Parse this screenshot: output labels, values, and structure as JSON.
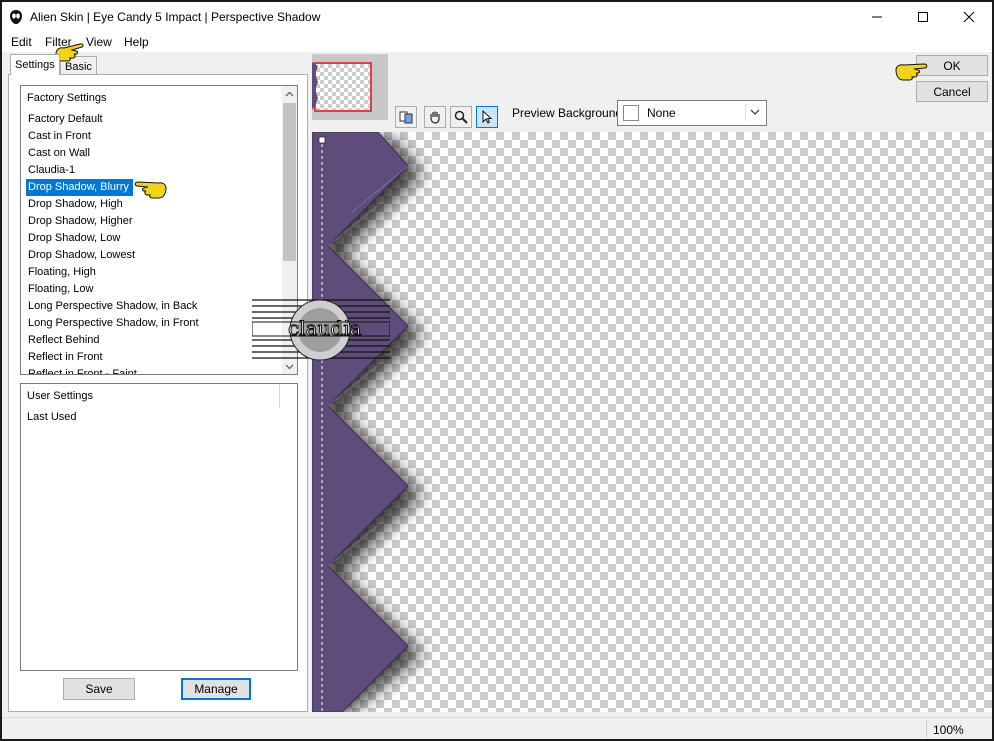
{
  "window": {
    "title": "Alien Skin | Eye Candy 5 Impact | Perspective Shadow"
  },
  "menu": [
    "Edit",
    "Filter",
    "View",
    "Help"
  ],
  "tabs": {
    "settings": "Settings",
    "basic": "Basic"
  },
  "factory": {
    "header": "Factory Settings",
    "items": [
      "Factory Default",
      "Cast in Front",
      "Cast on Wall",
      "Claudia-1",
      "Drop Shadow, Blurry",
      "Drop Shadow, High",
      "Drop Shadow, Higher",
      "Drop Shadow, Low",
      "Drop Shadow, Lowest",
      "Floating, High",
      "Floating, Low",
      "Long Perspective Shadow, in Back",
      "Long Perspective Shadow, in Front",
      "Reflect Behind",
      "Reflect in Front",
      "Reflect in Front - Faint"
    ],
    "selected_index": 4
  },
  "user": {
    "header": "User Settings",
    "items": [
      "Last Used"
    ]
  },
  "buttons": {
    "save": "Save",
    "manage": "Manage",
    "ok": "OK",
    "cancel": "Cancel"
  },
  "preview_background": {
    "label": "Preview Background:",
    "value": "None"
  },
  "status": {
    "zoom": "100%"
  },
  "watermark": {
    "text": "claudia"
  },
  "colors": {
    "selection": "#0078d7",
    "shape": "#5f4c7a",
    "pointer": "#f2d21b"
  }
}
